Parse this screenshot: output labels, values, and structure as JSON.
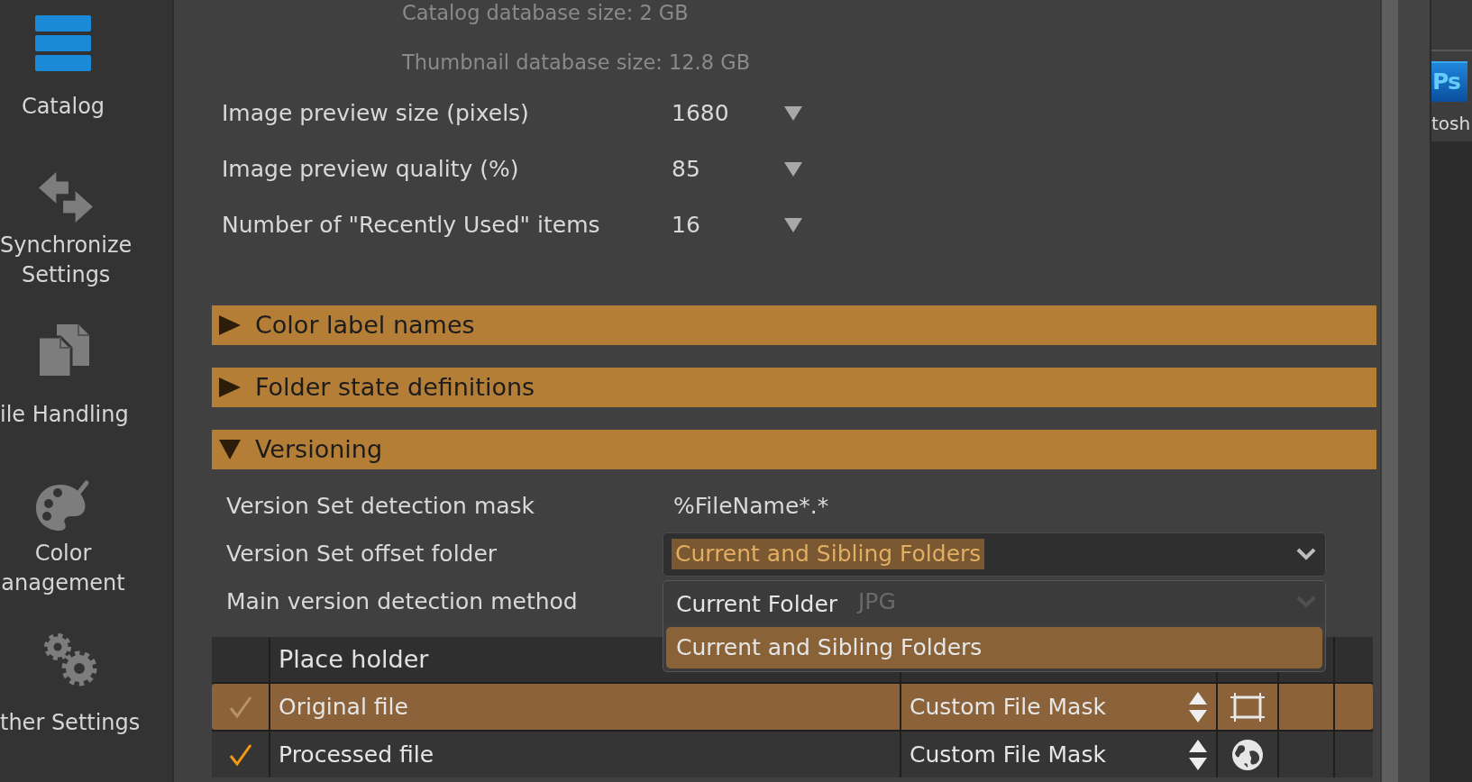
{
  "sidebar": {
    "items": [
      {
        "lines": [
          "Catalog"
        ],
        "selected": true
      },
      {
        "lines": [
          "Synchronize",
          "Settings"
        ],
        "selected": false
      },
      {
        "lines": [
          "ile Handling"
        ],
        "selected": false
      },
      {
        "lines": [
          "Color",
          "anagement"
        ],
        "selected": false
      },
      {
        "lines": [
          "ther Settings"
        ],
        "selected": false
      }
    ]
  },
  "catalog_info": [
    "Catalog database size: 2 GB",
    "Thumbnail database size: 12.8 GB"
  ],
  "settings": [
    {
      "label": "Image preview size (pixels)",
      "value": "1680"
    },
    {
      "label": "Image preview quality (%)",
      "value": "85"
    },
    {
      "label": "Number of \"Recently Used\" items",
      "value": "16"
    }
  ],
  "sections": [
    {
      "title": "Color label names",
      "expanded": false
    },
    {
      "title": "Folder state definitions",
      "expanded": false
    },
    {
      "title": "Versioning",
      "expanded": true,
      "fields": [
        {
          "kind": "text",
          "label": "Version Set detection mask",
          "value": "%FileName*.*"
        },
        {
          "kind": "dropdown",
          "label": "Version Set offset folder",
          "value": "Current and Sibling Folders",
          "open": true,
          "options": [
            {
              "label": "Current Folder",
              "selected": false
            },
            {
              "label": "Current and Sibling Folders",
              "selected": true
            }
          ]
        },
        {
          "kind": "dropdown",
          "label": "Main version detection method",
          "value": "JPG"
        }
      ],
      "table": {
        "columns": [
          "Place holder"
        ],
        "rows": [
          {
            "checked": true,
            "selected": true,
            "name": "Original file",
            "mask": "Custom File Mask"
          },
          {
            "checked": true,
            "selected": false,
            "name": "Processed file",
            "mask": "Custom File Mask"
          }
        ]
      }
    }
  ],
  "side_window": {
    "app_icon": "Ps",
    "app_label": "tosh"
  }
}
